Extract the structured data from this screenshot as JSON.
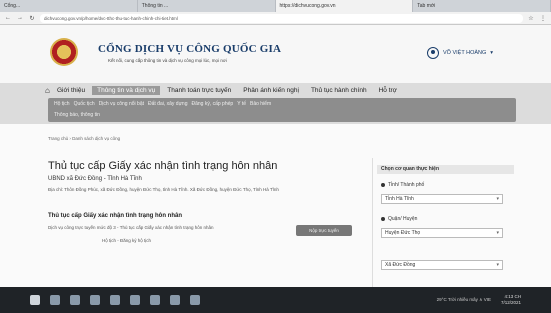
{
  "browser": {
    "tabs": [
      "Cổng...",
      "Thông tin ...",
      "https://dichvucong.gov.vn",
      "Tab mới"
    ],
    "url": "dichvucong.gov.vn/p/home/dvc-tthc-thu-tuc-hanh-chinh-chi-tiet.html"
  },
  "header": {
    "title": "CỔNG DỊCH VỤ CÔNG QUỐC GIA",
    "subtitle": "Kết nối, cung cấp thông tin và dịch vụ công mọi lúc, mọi nơi",
    "user": "VÕ VIỆT HOÀNG"
  },
  "mainnav": [
    {
      "label": "Giới thiệu",
      "active": false
    },
    {
      "label": "Thông tin và dịch vụ",
      "active": true
    },
    {
      "label": "Thanh toán trực tuyến",
      "active": false
    },
    {
      "label": "Phản ánh kiến nghị",
      "active": false
    },
    {
      "label": "Thủ tục hành chính",
      "active": false
    },
    {
      "label": "Hỗ trợ",
      "active": false
    }
  ],
  "subnav": {
    "row1": [
      "Hộ tịch",
      "Quốc tịch",
      "Dịch vụ công nổi bật",
      "Đất đai, xây dựng",
      "Đăng ký, cấp phép",
      "Y tế",
      "Bảo hiểm"
    ],
    "row2": [
      "Thông báo, thông tin"
    ]
  },
  "content": {
    "breadcrumb": "Trang chủ › Danh sách dịch vụ công",
    "title": "Thủ tục cấp Giấy xác nhận tình trạng hôn nhân",
    "org": "UBND xã Đức Đồng - Tỉnh Hà Tĩnh",
    "address": "Địa chỉ: Thôn Đồng Phúc, xã Đức Đồng, huyện Đức Thọ, tỉnh Hà Tĩnh. Xã Đức Đồng, huyện Đức Thọ, Tỉnh Hà Tĩnh",
    "section_title": "Thủ tục cấp Giấy xác nhận tình trạng hôn nhân",
    "proc_text": "Dịch vụ công trực tuyến mức độ 3 - Thủ tục cấp Giấy xác nhận tình trạng hôn nhân",
    "proc_text2": "Hộ tịch - Đăng ký hộ tịch",
    "proc_button": "Nộp trực tuyến"
  },
  "side": {
    "header": "Chọn cơ quan thực hiện",
    "radio1": "Tỉnh/ Thành phố",
    "select1": "Tỉnh Hà Tĩnh",
    "radio2": "Quận/ Huyện",
    "select2": "Huyện Đức Thọ",
    "select3": "Xã Đức Đồng"
  },
  "taskbar": {
    "system": "29°C  Trời nhiều mây  ∧  VIE",
    "time": "4:13 CH",
    "date": "7/12/2021"
  }
}
